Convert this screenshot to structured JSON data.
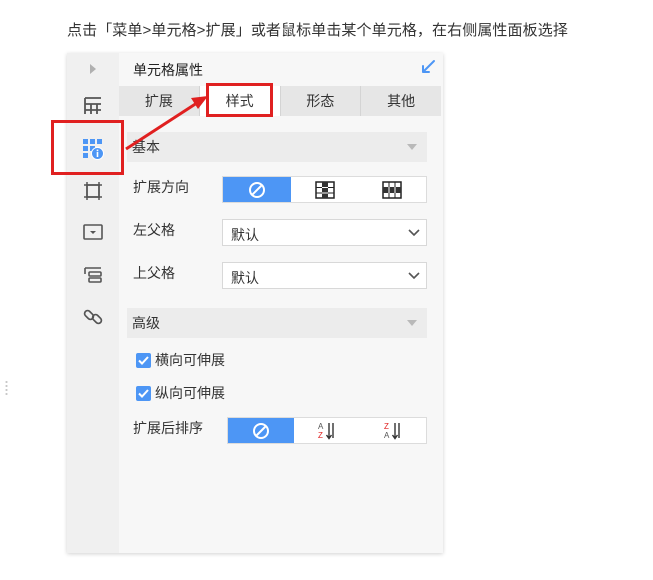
{
  "instruction": "点击「菜单>单元格>扩展」或者鼠标单击某个单元格，在右侧属性面板选择",
  "panel": {
    "title": "单元格属性",
    "tabs": [
      {
        "label": "扩展",
        "active": false
      },
      {
        "label": "样式",
        "active": true
      },
      {
        "label": "形态",
        "active": false
      },
      {
        "label": "其他",
        "active": false
      }
    ]
  },
  "sidebar": {
    "icons": [
      "collapse-arrow-icon",
      "table-icon",
      "cell-properties-icon",
      "frame-icon",
      "widget-icon",
      "layers-icon",
      "link-icon"
    ]
  },
  "basic": {
    "title": "基本",
    "expand_direction_label": "扩展方向",
    "expand_direction_options": [
      "none-icon",
      "vertical-grid-icon",
      "horizontal-grid-icon"
    ],
    "left_parent_label": "左父格",
    "left_parent_value": "默认",
    "top_parent_label": "上父格",
    "top_parent_value": "默认"
  },
  "advanced": {
    "title": "高级",
    "checkbox_horizontal": "横向可伸展",
    "checkbox_vertical": "纵向可伸展",
    "sort_label": "扩展后排序",
    "sort_options": [
      "none-icon",
      "sort-ascending-icon",
      "sort-descending-icon"
    ],
    "sort_icon_text": {
      "asc_top": "A",
      "asc_bottom": "Z",
      "desc_top": "Z",
      "desc_bottom": "A"
    }
  },
  "colors": {
    "accent": "#4d96f5",
    "highlight": "#e02020"
  }
}
